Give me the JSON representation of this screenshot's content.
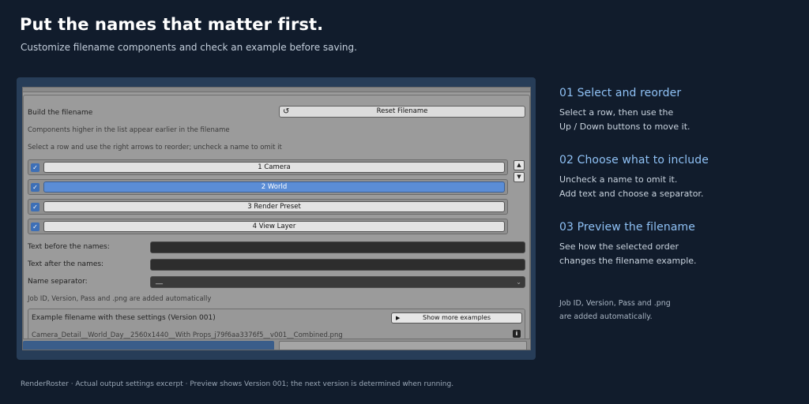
{
  "header": {
    "title": "Put the names that matter first.",
    "subtitle": "Customize filename components and check an example before saving."
  },
  "panel": {
    "build_label": "Build the filename",
    "reset_label": "Reset Filename",
    "reset_icon": "undo-arrow-icon",
    "hint_order": "Components higher in the list appear earlier in the filename",
    "hint_reorder": "Select a row and use the right arrows to reorder; uncheck a name to omit it",
    "components": [
      {
        "label": "1  Camera",
        "checked": true,
        "selected": false
      },
      {
        "label": "2  World",
        "checked": true,
        "selected": true
      },
      {
        "label": "3  Render Preset",
        "checked": true,
        "selected": false
      },
      {
        "label": "4  View Layer",
        "checked": true,
        "selected": false
      }
    ],
    "move_up_icon": "triangle-up-icon",
    "move_down_icon": "triangle-down-icon",
    "text_before_label": "Text before the names:",
    "text_before_value": "",
    "text_after_label": "Text after the names:",
    "text_after_value": "",
    "separator_label": "Name separator:",
    "separator_value": "__",
    "auto_note": "Job ID, Version, Pass and .png are added automatically",
    "example_title": "Example filename with these settings (Version 001)",
    "show_more_label": "Show more examples",
    "example_filename": "Camera_Detail__World_Day__2560x1440__With Props_j79f6aa3376f5__v001__Combined.png"
  },
  "steps": [
    {
      "title": "01 Select and reorder",
      "line1": "Select a row, then use the",
      "line2": "Up / Down buttons to move it."
    },
    {
      "title": "02 Choose what to include",
      "line1": "Uncheck a name to omit it.",
      "line2": "Add text and choose a separator."
    },
    {
      "title": "03 Preview the filename",
      "line1": "See how the selected order",
      "line2": "changes the filename example."
    }
  ],
  "note": {
    "line1": "Job ID, Version, Pass and .png",
    "line2": "are added automatically."
  },
  "footer": "RenderRoster · Actual output settings excerpt · Preview shows Version 001; the next version is determined when running.",
  "colors": {
    "background": "#111c2c",
    "accent": "#8fc1f5",
    "selected_row": "#5b8dd6",
    "checkbox": "#3d6fb6"
  }
}
